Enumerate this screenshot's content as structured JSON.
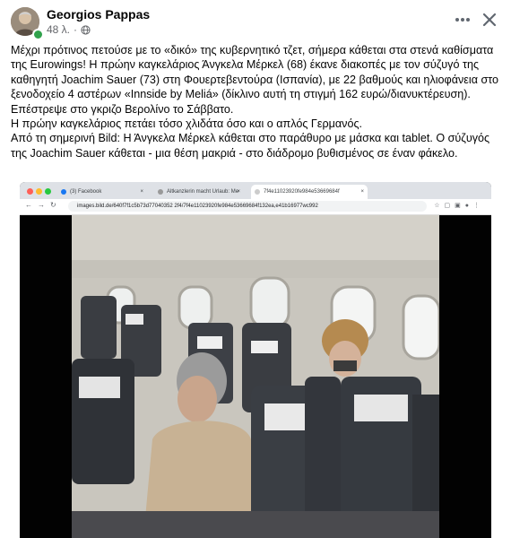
{
  "post": {
    "author": "Georgios Pappas",
    "time": "48 λ.",
    "more_icon": "more-horizontal-icon",
    "close_icon": "close-icon",
    "paragraphs": [
      "Μέχρι πρότινος πετούσε με το «δικό» της κυβερνητικό τζετ, σήμερα κάθεται στα στενά καθίσματα της Eurowings! Η πρώην καγκελάριος Άνγκελα Μέρκελ (68) έκανε διακοπές με τον σύζυγό της καθηγητή Joachim Sauer (73) στη Φουερτεβεντούρα (Ισπανία), με 22 βαθμούς και ηλιοφάνεια στο ξενοδοχείο 4 αστέρων «Innside by Meliá» (δίκλινο αυτή τη στιγμή 162 ευρώ/διανυκτέρευση). Επέστρεψε στο γκριζο Βερολίνο το Σάββατο.",
      "Η πρώην καγκελάριος πετάει τόσο χλιδάτα όσο και ο απλός Γερμανός.",
      "Από τη σημερινή Bild: Η Άνγκελα Μέρκελ κάθεται στο παράθυρο με μάσκα και tablet. Ο σύζυγός της Joachim Sauer κάθεται - μια θέση μακριά - στο διάδρομο βυθισμένος σε έναν φάκελο."
    ]
  },
  "browser": {
    "tabs": [
      {
        "label": "(3) Facebook",
        "color": "#1877f2"
      },
      {
        "label": "Altkanzlerin macht Urlaub: Me",
        "color": "#999999"
      },
      {
        "label": "7f4e11023920fe984e53669684f",
        "color": "#cccccc"
      }
    ],
    "url": "images.bild.de/640f7f1c5b73d77040352 2f4/7f4e11023920fe984e53669684f132ea,e41b16977wc992"
  },
  "colors": {
    "text": "#050505",
    "secondary": "#65676b",
    "online": "#31a24c"
  }
}
